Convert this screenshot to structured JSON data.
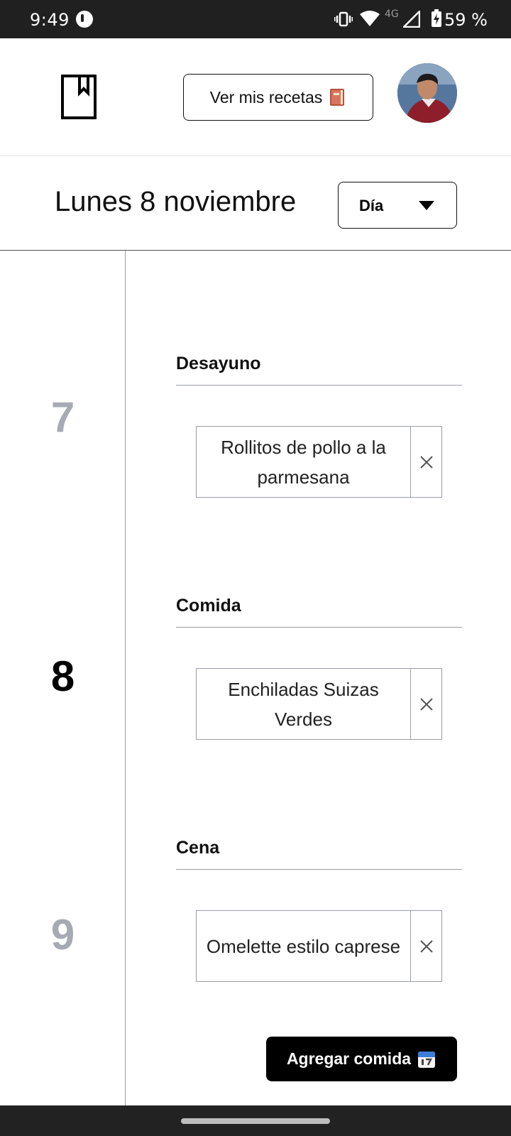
{
  "status_bar": {
    "time": "9:49",
    "network": "4G",
    "battery": "59 %"
  },
  "header": {
    "logo_icon": "bookmark-icon",
    "recipes_button_label": "Ver mis recetas",
    "recipes_button_emoji": "book-emoji",
    "avatar": "user-avatar-photo"
  },
  "date_bar": {
    "title": "Lunes 8 noviembre",
    "view_select": "Día"
  },
  "timeline": {
    "hours": [
      "7",
      "8",
      "9"
    ],
    "current_hour": "8",
    "meals": [
      {
        "label": "Desayuno",
        "recipe": "Rollitos de pollo a la parmesana"
      },
      {
        "label": "Comida",
        "recipe": "Enchiladas Suizas Verdes"
      },
      {
        "label": "Cena",
        "recipe": "Omelette estilo caprese"
      }
    ]
  },
  "add_meal_button_label": "Agregar comida",
  "colors": {
    "status_bar_bg": "#202020",
    "hour_dim": "#a7aab2",
    "divider": "#9a9ea8",
    "primary_button_bg": "#000000"
  }
}
